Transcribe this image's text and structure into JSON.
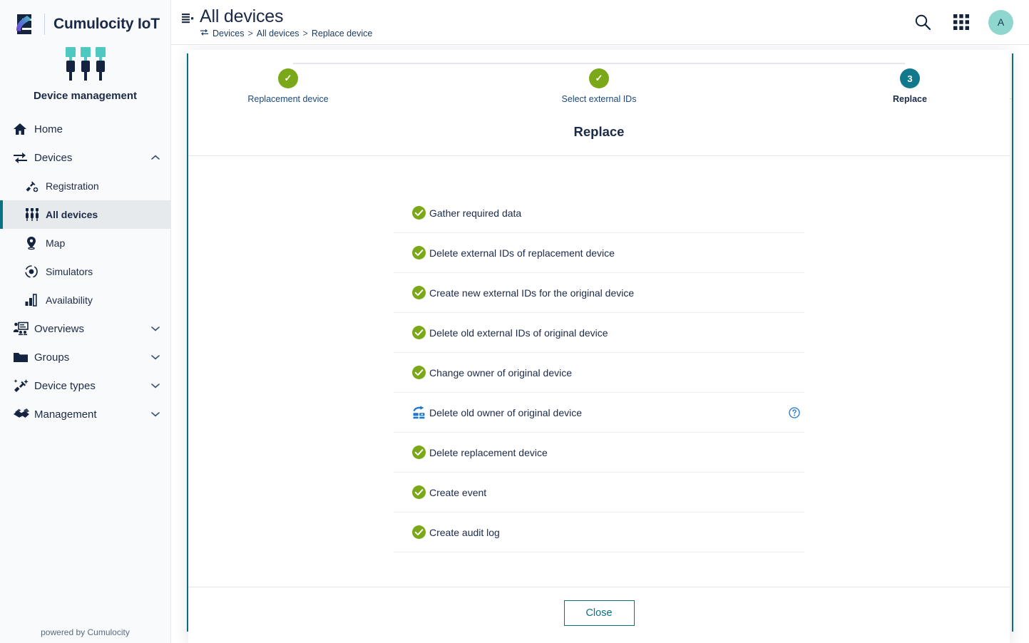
{
  "brand": {
    "title": "Cumulocity IoT",
    "app_name": "Device management",
    "logo_icon": "cumulocity-s-logo",
    "app_icon": "device-management-plugs-icon"
  },
  "sidebar": {
    "items": [
      {
        "label": "Home",
        "icon": "home-icon",
        "level": "top",
        "active": false,
        "caret": ""
      },
      {
        "label": "Devices",
        "icon": "devices-transfer-icon",
        "level": "top",
        "active": false,
        "caret": "chevron-up-icon"
      },
      {
        "label": "Registration",
        "icon": "plug-plus-icon",
        "level": "sub",
        "active": false,
        "caret": ""
      },
      {
        "label": "All devices",
        "icon": "all-devices-icon",
        "level": "sub",
        "active": true,
        "caret": ""
      },
      {
        "label": "Map",
        "icon": "map-pin-icon",
        "level": "sub",
        "active": false,
        "caret": ""
      },
      {
        "label": "Simulators",
        "icon": "simulators-icon",
        "level": "sub",
        "active": false,
        "caret": ""
      },
      {
        "label": "Availability",
        "icon": "bar-chart-icon",
        "level": "sub",
        "active": false,
        "caret": ""
      },
      {
        "label": "Overviews",
        "icon": "overviews-presentation-icon",
        "level": "top",
        "active": false,
        "caret": "chevron-down-icon"
      },
      {
        "label": "Groups",
        "icon": "folder-icon",
        "level": "top",
        "active": false,
        "caret": "chevron-down-icon"
      },
      {
        "label": "Device types",
        "icon": "device-types-plug-icon",
        "level": "top",
        "active": false,
        "caret": "chevron-down-icon"
      },
      {
        "label": "Management",
        "icon": "handshake-icon",
        "level": "top",
        "active": false,
        "caret": "chevron-down-icon"
      }
    ],
    "footer_text": "powered by Cumulocity"
  },
  "topbar": {
    "title": "All devices",
    "title_icon": "list-details-icon",
    "breadcrumb_icon": "devices-transfer-icon",
    "breadcrumb": [
      "Devices",
      "All devices",
      "Replace device"
    ],
    "breadcrumb_separator": ">",
    "actions": [
      {
        "name": "search-icon",
        "label": "Search"
      },
      {
        "name": "app-switcher-icon",
        "label": "App switcher"
      }
    ],
    "avatar_initial": "A"
  },
  "modal": {
    "heading": "Replace",
    "steps": [
      {
        "label": "Replacement device",
        "state": "done",
        "marker": "✓"
      },
      {
        "label": "Select external IDs",
        "state": "done",
        "marker": "✓"
      },
      {
        "label": "Replace",
        "state": "current",
        "marker": "3"
      }
    ],
    "tasks": [
      {
        "label": "Gather required data",
        "status": "success",
        "icon": "check-circle-icon",
        "help": false
      },
      {
        "label": "Delete external IDs of replacement device",
        "status": "success",
        "icon": "check-circle-icon",
        "help": false
      },
      {
        "label": "Create new external IDs for the original device",
        "status": "success",
        "icon": "check-circle-icon",
        "help": false
      },
      {
        "label": "Delete old external IDs of original device",
        "status": "success",
        "icon": "check-circle-icon",
        "help": false
      },
      {
        "label": "Change owner of original device",
        "status": "success",
        "icon": "check-circle-icon",
        "help": false
      },
      {
        "label": "Delete old owner of original device",
        "status": "skipped",
        "icon": "skip-server-icon",
        "help": true,
        "help_icon": "question-circle-icon"
      },
      {
        "label": "Delete replacement device",
        "status": "success",
        "icon": "check-circle-icon",
        "help": false
      },
      {
        "label": "Create event",
        "status": "success",
        "icon": "check-circle-icon",
        "help": false
      },
      {
        "label": "Create audit log",
        "status": "success",
        "icon": "check-circle-icon",
        "help": false
      }
    ],
    "close_label": "Close"
  },
  "colors": {
    "brand_navy": "#1b2a47",
    "accent_teal": "#0b7282",
    "step_done_green": "#7ba818",
    "step_current_teal": "#12788c",
    "success_green": "#7ba818",
    "skipped_blue": "#2076c9",
    "avatar_bg": "#8fd6cf",
    "sidebar_bg": "#f9fafb",
    "active_item_bg": "#e7eaed"
  }
}
